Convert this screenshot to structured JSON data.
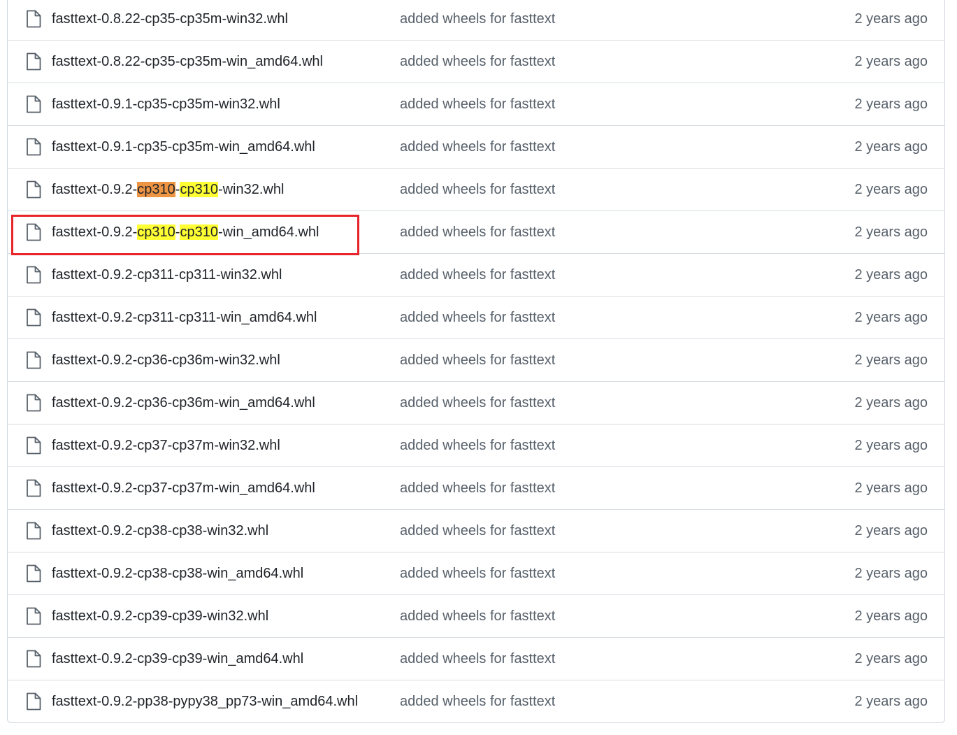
{
  "files": [
    {
      "name": "fasttext-0.8.22-cp35-cp35m-win32.whl",
      "commit_message": "added wheels for fasttext",
      "age": "2 years ago"
    },
    {
      "name": "fasttext-0.8.22-cp35-cp35m-win_amd64.whl",
      "commit_message": "added wheels for fasttext",
      "age": "2 years ago"
    },
    {
      "name": "fasttext-0.9.1-cp35-cp35m-win32.whl",
      "commit_message": "added wheels for fasttext",
      "age": "2 years ago"
    },
    {
      "name": "fasttext-0.9.1-cp35-cp35m-win_amd64.whl",
      "commit_message": "added wheels for fasttext",
      "age": "2 years ago"
    },
    {
      "name": "fasttext-0.9.2-cp310-cp310-win32.whl",
      "commit_message": "added wheels for fasttext",
      "age": "2 years ago"
    },
    {
      "name": "fasttext-0.9.2-cp310-cp310-win_amd64.whl",
      "commit_message": "added wheels for fasttext",
      "age": "2 years ago"
    },
    {
      "name": "fasttext-0.9.2-cp311-cp311-win32.whl",
      "commit_message": "added wheels for fasttext",
      "age": "2 years ago"
    },
    {
      "name": "fasttext-0.9.2-cp311-cp311-win_amd64.whl",
      "commit_message": "added wheels for fasttext",
      "age": "2 years ago"
    },
    {
      "name": "fasttext-0.9.2-cp36-cp36m-win32.whl",
      "commit_message": "added wheels for fasttext",
      "age": "2 years ago"
    },
    {
      "name": "fasttext-0.9.2-cp36-cp36m-win_amd64.whl",
      "commit_message": "added wheels for fasttext",
      "age": "2 years ago"
    },
    {
      "name": "fasttext-0.9.2-cp37-cp37m-win32.whl",
      "commit_message": "added wheels for fasttext",
      "age": "2 years ago"
    },
    {
      "name": "fasttext-0.9.2-cp37-cp37m-win_amd64.whl",
      "commit_message": "added wheels for fasttext",
      "age": "2 years ago"
    },
    {
      "name": "fasttext-0.9.2-cp38-cp38-win32.whl",
      "commit_message": "added wheels for fasttext",
      "age": "2 years ago"
    },
    {
      "name": "fasttext-0.9.2-cp38-cp38-win_amd64.whl",
      "commit_message": "added wheels for fasttext",
      "age": "2 years ago"
    },
    {
      "name": "fasttext-0.9.2-cp39-cp39-win32.whl",
      "commit_message": "added wheels for fasttext",
      "age": "2 years ago"
    },
    {
      "name": "fasttext-0.9.2-cp39-cp39-win_amd64.whl",
      "commit_message": "added wheels for fasttext",
      "age": "2 years ago"
    },
    {
      "name": "fasttext-0.9.2-pp38-pypy38_pp73-win_amd64.whl",
      "commit_message": "added wheels for fasttext",
      "age": "2 years ago"
    }
  ],
  "search_highlight": {
    "term": "cp310",
    "current_match_file_index": 4,
    "current_match_occurrence": 0,
    "highlight_color": "#ffff33",
    "current_highlight_color": "#ee9544"
  },
  "annotation": {
    "highlighted_file_index": 5,
    "box_color": "#e8232a"
  },
  "colors": {
    "file_name": "#1f2328",
    "muted_text": "#57606a",
    "border": "#d0d7de",
    "icon": "#57606a"
  },
  "icons": {
    "file": "file-icon"
  }
}
